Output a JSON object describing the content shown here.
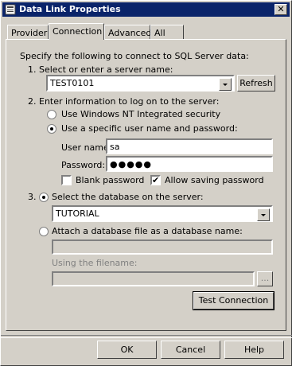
{
  "window": {
    "title": "Data Link Properties"
  },
  "tabs": [
    {
      "label": "Provider"
    },
    {
      "label": "Connection"
    },
    {
      "label": "Advanced"
    },
    {
      "label": "All"
    }
  ],
  "intro": "Specify the following to connect to SQL Server data:",
  "step1": {
    "label": "1. Select or enter a server name:",
    "server_value": "TEST0101",
    "refresh_label": "Refresh"
  },
  "step2": {
    "label": "2. Enter information to log on to the server:",
    "radio_nt": "Use Windows NT Integrated security",
    "radio_specific": "Use a specific user name and password:",
    "user_label": "User name:",
    "user_value": "sa",
    "password_label": "Password:",
    "password_value": "●●●●●",
    "blank_password": "Blank password",
    "allow_saving": "Allow saving password"
  },
  "step3": {
    "number": "3.",
    "radio_select_db": "Select the database on the server:",
    "db_value": "TUTORIAL",
    "radio_attach": "Attach a database file as a database name:",
    "filename_label": "Using the filename:",
    "browse_label": "...",
    "test_label": "Test Connection"
  },
  "footer": {
    "ok": "OK",
    "cancel": "Cancel",
    "help": "Help"
  }
}
